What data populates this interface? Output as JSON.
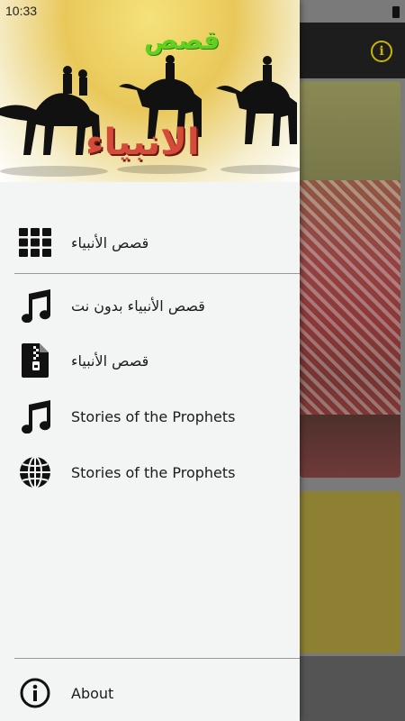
{
  "status_bar": {
    "time": "10:33"
  },
  "drawer": {
    "header": {
      "title_top": "قصص",
      "title_main": "الانبياء"
    },
    "items": [
      {
        "label": "قصص الأنبياء",
        "icon": "grid-icon"
      },
      {
        "label": "قصص الأنبياء بدون نت",
        "icon": "music-note-icon"
      },
      {
        "label": "قصص الأنبياء",
        "icon": "zip-file-icon"
      },
      {
        "label": "Stories of the Prophets",
        "icon": "music-note-icon"
      },
      {
        "label": "Stories of the Prophets",
        "icon": "globe-icon"
      }
    ],
    "about": {
      "label": "About",
      "icon": "info-icon"
    }
  },
  "background_app": {
    "info_icon": "info-icon"
  },
  "colors": {
    "drawer_bg": "#f3f5f4",
    "icon": "#111111",
    "banner_green": "#5fd11f",
    "banner_red": "#d64a3a"
  }
}
